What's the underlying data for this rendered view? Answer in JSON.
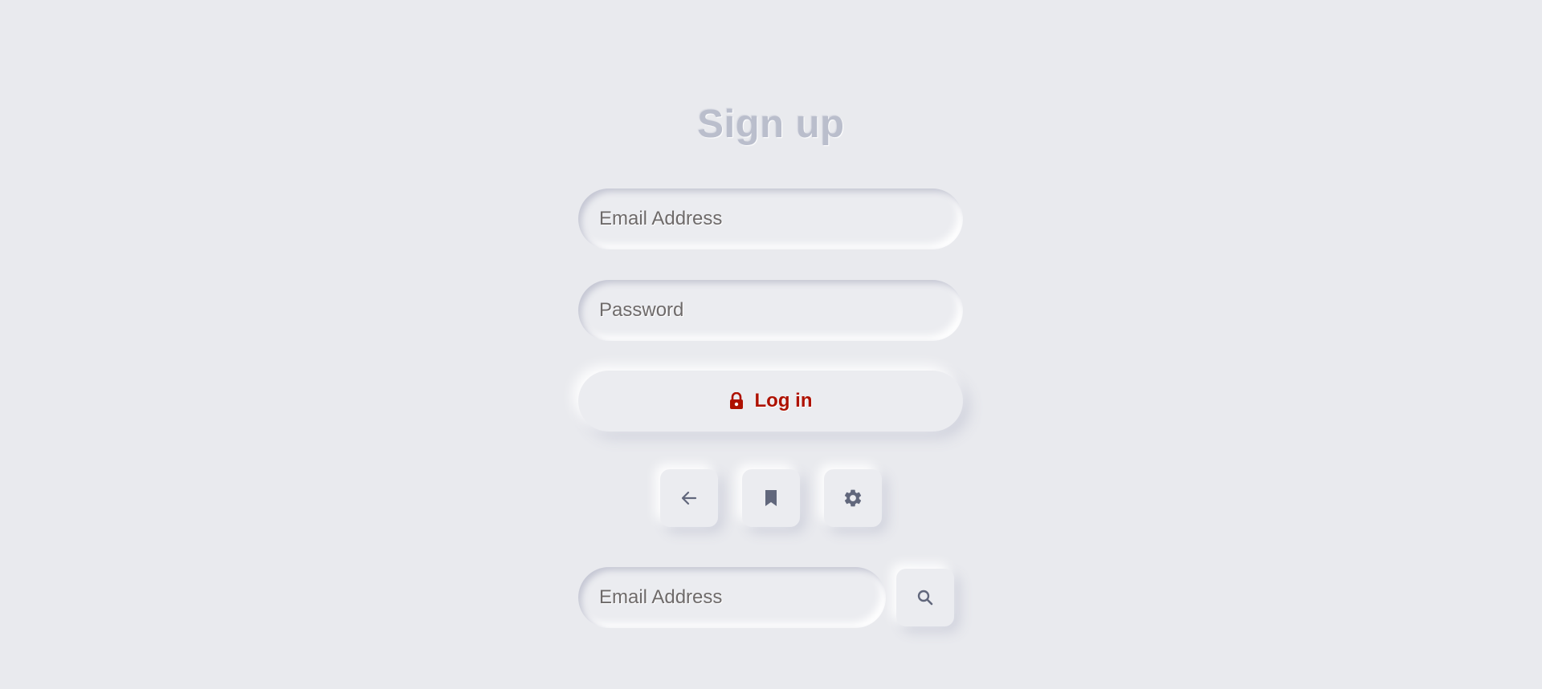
{
  "page": {
    "title": "Sign up"
  },
  "form": {
    "email": {
      "value": "",
      "placeholder": "Email Address"
    },
    "password": {
      "value": "",
      "placeholder": "Password"
    },
    "login_button": {
      "label": "Log in",
      "icon": "lock-icon"
    }
  },
  "icon_buttons": [
    {
      "name": "back",
      "icon": "arrow-left-icon"
    },
    {
      "name": "bookmark",
      "icon": "bookmark-icon"
    },
    {
      "name": "settings",
      "icon": "gear-icon"
    }
  ],
  "search": {
    "value": "",
    "placeholder": "Email Address",
    "button_icon": "search-icon"
  },
  "colors": {
    "background": "#e9eaee",
    "title": "#babecc",
    "accent": "#ae1100",
    "icon": "#61677c",
    "placeholder": "#6e6a6a"
  }
}
